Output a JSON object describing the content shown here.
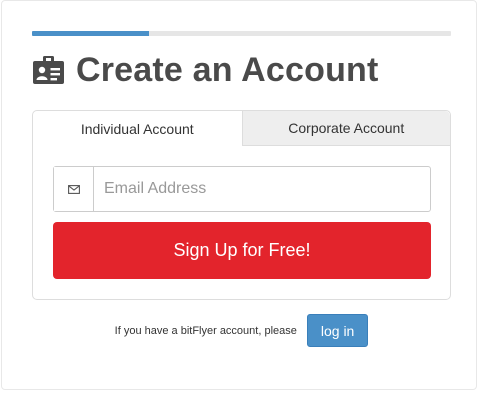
{
  "signup": {
    "progress": 0.28,
    "title": "Create an Account",
    "title_icon": "id-card-icon",
    "tabs": [
      {
        "label": "Individual Account",
        "active": true
      },
      {
        "label": "Corporate Account",
        "active": false
      }
    ],
    "email": {
      "icon": "envelope-icon",
      "value": "",
      "placeholder": "Email Address"
    },
    "signup_button_label": "Sign Up for Free!",
    "login_prompt": "If you have a bitFlyer account, please",
    "login_button_label": "log in"
  },
  "colors": {
    "accent_blue": "#4a90c8",
    "signup_red": "#e3242c",
    "title_gray": "#4a4a4a",
    "inactive_tab": "#eeeeee"
  }
}
